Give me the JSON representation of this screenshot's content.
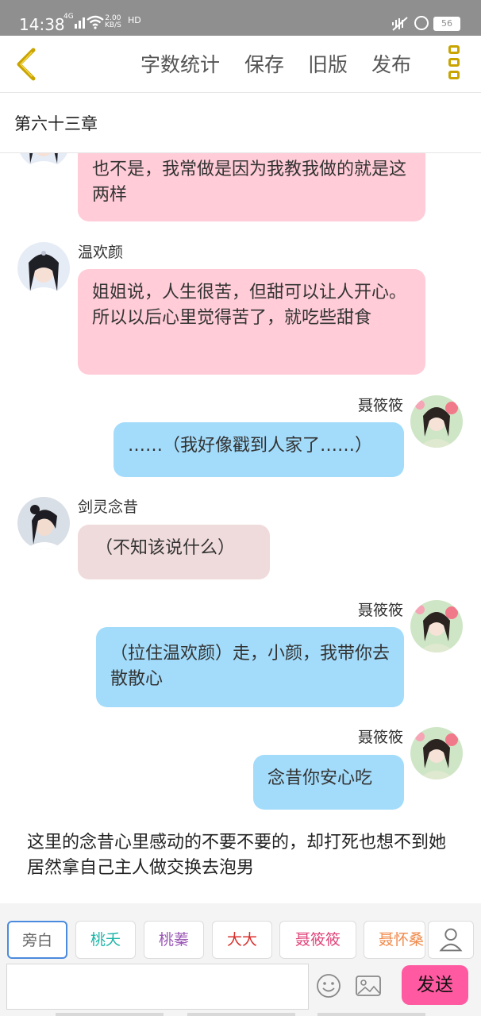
{
  "status_bar": {
    "time": "14:38",
    "network": "4G",
    "speed_top": "2.00",
    "speed_bottom": "KB/S",
    "hd": "HD",
    "battery": "56",
    "icons": [
      "signal-icon",
      "wifi-icon",
      "mute-icon",
      "rotation-lock-icon",
      "battery-icon"
    ]
  },
  "toolbar": {
    "back_icon": "chevron-left-icon",
    "word_count_label": "字数统计",
    "save_label": "保存",
    "old_version_label": "旧版",
    "publish_label": "发布",
    "menu_icon": "more-vertical-icon",
    "accent_color": "#c9a400"
  },
  "chapter": {
    "title": "第六十三章"
  },
  "messages": [
    {
      "speaker": "",
      "side": "left",
      "text": "也不是，我常做是因为我教我做的就是这两样",
      "color": "#ffccd8"
    },
    {
      "speaker": "温欢颜",
      "side": "left",
      "text": "姐姐说，人生很苦，但甜可以让人开心。所以以后心里觉得苦了，就吃些甜食",
      "color": "#ffccd8"
    },
    {
      "speaker": "聂筱筱",
      "side": "right",
      "text": "……（我好像戳到人家了……）",
      "color": "#a3dcfb"
    },
    {
      "speaker": "剑灵念昔",
      "side": "left",
      "text": "（不知该说什么）",
      "color": "#f0dbdc"
    },
    {
      "speaker": "聂筱筱",
      "side": "right",
      "text": "（拉住温欢颜）走，小颜，我带你去散散心",
      "color": "#a3dcfb"
    },
    {
      "speaker": "聂筱筱",
      "side": "right",
      "text": "念昔你安心吃",
      "color": "#a3dcfb"
    }
  ],
  "narration": "这里的念昔心里感动的不要不要的，却打死也想不到她居然拿自己主人做交换去泡男",
  "role_selector": [
    {
      "label": "旁白",
      "color": "#666666",
      "active": true
    },
    {
      "label": "桃夭",
      "color": "#1fb5a8",
      "active": false
    },
    {
      "label": "桃蓁",
      "color": "#9b59b6",
      "active": false
    },
    {
      "label": "大大",
      "color": "#d9302c",
      "active": false
    },
    {
      "label": "聂筱筱",
      "color": "#e0457b",
      "active": false
    },
    {
      "label": "聂怀桑",
      "color": "#f08a4b",
      "active": false
    }
  ],
  "composer": {
    "input_value": "",
    "emoji_icon": "emoji-icon",
    "image_icon": "image-icon",
    "contact_icon": "user-icon",
    "send_label": "发送",
    "send_color": "#ff5aa1"
  }
}
